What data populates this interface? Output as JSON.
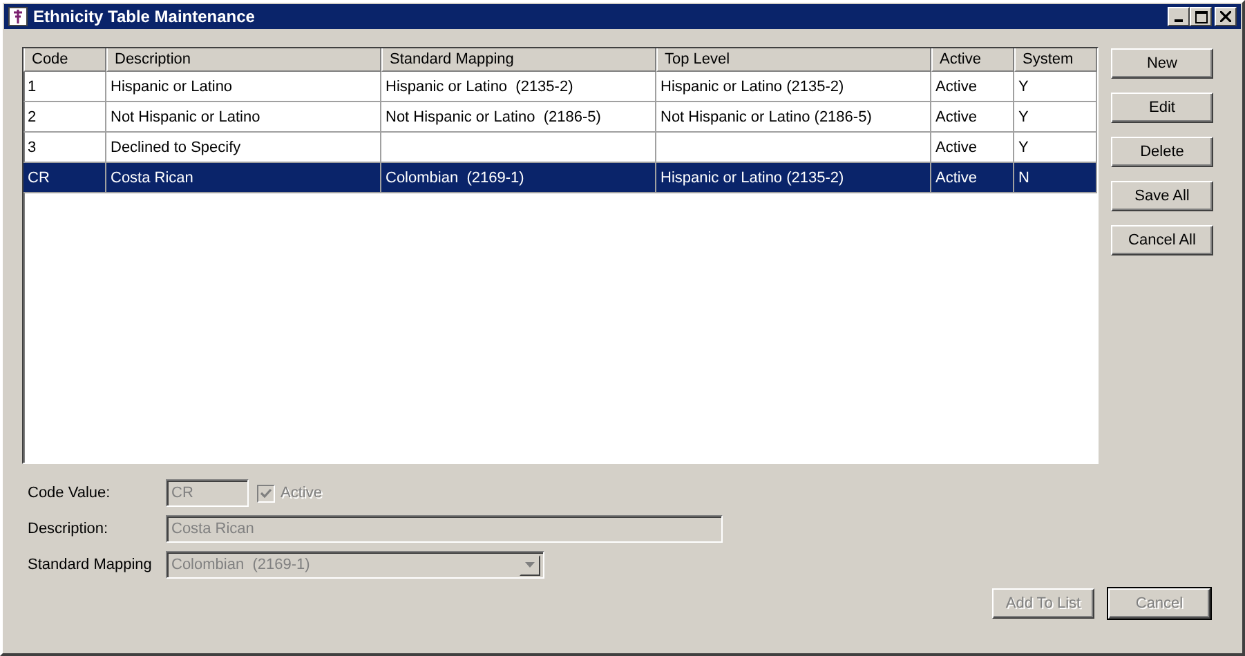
{
  "window": {
    "title": "Ethnicity Table Maintenance"
  },
  "table": {
    "columns": [
      "Code",
      "Description",
      "Standard Mapping",
      "Top Level",
      "Active",
      "System"
    ],
    "rows": [
      {
        "cells": [
          "1",
          "Hispanic or Latino",
          "Hispanic or Latino  (2135-2)",
          "Hispanic or Latino (2135-2)",
          "Active",
          "Y"
        ],
        "selected": false
      },
      {
        "cells": [
          "2",
          "Not Hispanic or Latino",
          "Not Hispanic or Latino  (2186-5)",
          "Not Hispanic or Latino (2186-5)",
          "Active",
          "Y"
        ],
        "selected": false
      },
      {
        "cells": [
          "3",
          "Declined to Specify",
          "",
          "",
          "Active",
          "Y"
        ],
        "selected": false
      },
      {
        "cells": [
          "CR",
          "Costa Rican",
          "Colombian  (2169-1)",
          "Hispanic or Latino (2135-2)",
          "Active",
          "N"
        ],
        "selected": true
      }
    ]
  },
  "side_buttons": [
    "New",
    "Edit",
    "Delete",
    "Save All",
    "Cancel All"
  ],
  "form": {
    "code_value": {
      "label": "Code Value:",
      "value": "CR",
      "disabled": true
    },
    "active": {
      "label": "Active",
      "checked": true,
      "disabled": true
    },
    "description": {
      "label": "Description:",
      "value": "Costa Rican",
      "disabled": true
    },
    "standard_mapping": {
      "label": "Standard Mapping",
      "value": "Colombian  (2169-1)",
      "disabled": true
    }
  },
  "bottom_buttons": [
    {
      "label": "Add To List",
      "disabled": true,
      "default": false
    },
    {
      "label": "Cancel",
      "disabled": true,
      "default": true
    }
  ]
}
